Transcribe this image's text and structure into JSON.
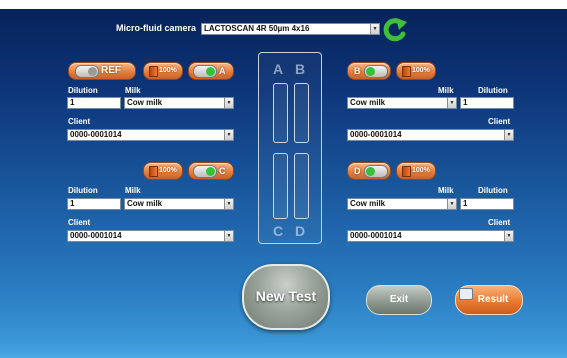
{
  "camera": {
    "label": "Micro-fluid camera",
    "value": "LACTOSCAN 4R 50µm 4x16",
    "refresh_icon": "refresh-icon"
  },
  "panels": {
    "a": {
      "ref_label": "REF",
      "battery": "100%",
      "channel_label": "A",
      "dilution_label": "Dilution",
      "dilution_value": "1",
      "milk_label": "Milk",
      "milk_value": "Cow milk",
      "client_label": "Client",
      "client_value": "0000-0001014"
    },
    "b": {
      "channel_label": "B",
      "battery": "100%",
      "milk_label": "Milk",
      "milk_value": "Cow milk",
      "dilution_label": "Dilution",
      "dilution_value": "1",
      "client_label": "Client",
      "client_value": "0000-0001014"
    },
    "c": {
      "battery": "100%",
      "channel_label": "C",
      "dilution_label": "Dilution",
      "dilution_value": "1",
      "milk_label": "Milk",
      "milk_value": "Cow milk",
      "client_label": "Client",
      "client_value": "0000-0001014"
    },
    "d": {
      "channel_label": "D",
      "battery": "100%",
      "milk_label": "Milk",
      "milk_value": "Cow milk",
      "dilution_label": "Dilution",
      "dilution_value": "1",
      "client_label": "Client",
      "client_value": "0000-0001014"
    }
  },
  "chip": {
    "letters": [
      "A",
      "B",
      "C",
      "D"
    ]
  },
  "buttons": {
    "new_test": "New Test",
    "exit": "Exit",
    "result": "Result"
  },
  "colors": {
    "accent_orange": "#e67f3f",
    "refresh_green": "#3fbf3a",
    "toggle_green": "#35c23a",
    "background_top": "#07235a",
    "background_bottom": "#4aa7e2"
  }
}
